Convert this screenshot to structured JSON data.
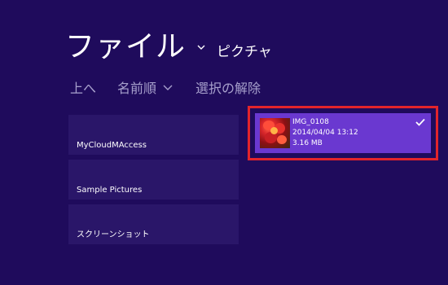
{
  "header": {
    "title": "ファイル",
    "location": "ピクチャ"
  },
  "toolbar": {
    "up_label": "上へ",
    "sort_label": "名前順",
    "deselect_label": "選択の解除"
  },
  "folders": [
    {
      "name": "MyCloudMAccess"
    },
    {
      "name": "Sample Pictures"
    },
    {
      "name": "スクリーンショット"
    }
  ],
  "file": {
    "name": "IMG_0108",
    "date": "2014/04/04 13:12",
    "size": "3.16 MB",
    "selected": true
  },
  "colors": {
    "background": "#1f0b5c",
    "tile": "#2a1669",
    "selected_tile": "#6a38d0",
    "highlight_border": "#e3242b"
  }
}
